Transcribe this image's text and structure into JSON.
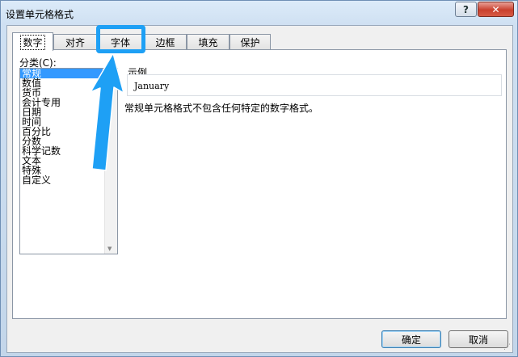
{
  "window": {
    "title": "设置单元格格式",
    "help_glyph": "?",
    "close_glyph": "✕"
  },
  "tabs": [
    {
      "label": "数字",
      "active": true
    },
    {
      "label": "对齐",
      "active": false
    },
    {
      "label": "字体",
      "active": false
    },
    {
      "label": "边框",
      "active": false
    },
    {
      "label": "填充",
      "active": false
    },
    {
      "label": "保护",
      "active": false
    }
  ],
  "category": {
    "label": "分类(C):",
    "items": [
      "常规",
      "数值",
      "货币",
      "会计专用",
      "日期",
      "时间",
      "百分比",
      "分数",
      "科学记数",
      "文本",
      "特殊",
      "自定义"
    ],
    "selected": "常规"
  },
  "sample": {
    "label": "示例",
    "value": "January"
  },
  "description": "常规单元格格式不包含任何特定的数字格式。",
  "buttons": {
    "ok": "确定",
    "cancel": "取消"
  },
  "annotation": {
    "color": "#1ea0f5",
    "target_tab": "字体"
  }
}
